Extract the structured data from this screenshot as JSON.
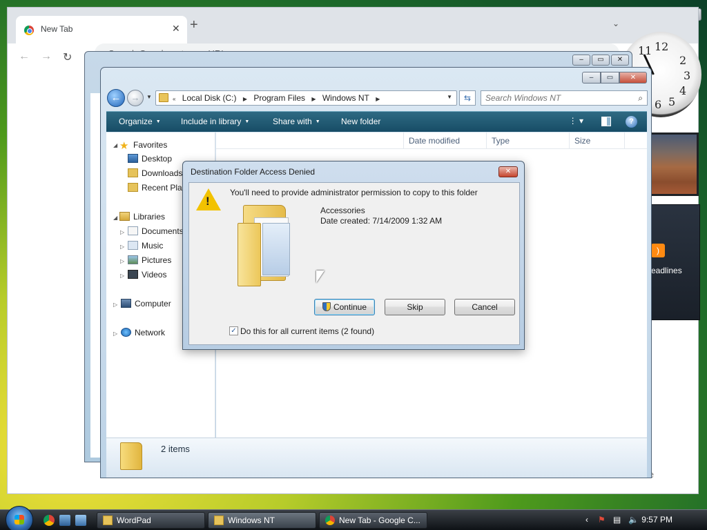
{
  "chrome": {
    "tab_title": "New Tab",
    "omnibox_placeholder": "Search Google or type a URL",
    "shortcut_text": "hrome"
  },
  "gadgets": {
    "feed_label": "eadlines"
  },
  "explorer": {
    "breadcrumbs": [
      "Local Disk (C:)",
      "Program Files",
      "Windows NT"
    ],
    "search_placeholder": "Search Windows NT",
    "toolbar": {
      "organize": "Organize",
      "include": "Include in library",
      "share": "Share with",
      "new_folder": "New folder"
    },
    "nav": {
      "favorites": "Favorites",
      "desktop": "Desktop",
      "downloads": "Downloads",
      "recent": "Recent Plac",
      "libraries": "Libraries",
      "documents": "Documents",
      "music": "Music",
      "pictures": "Pictures",
      "videos": "Videos",
      "computer": "Computer",
      "network": "Network"
    },
    "columns": {
      "name": "",
      "date": "Date modified",
      "type": "Type",
      "size": "Size"
    },
    "status_count": "2 items"
  },
  "dialog": {
    "title": "Destination Folder Access Denied",
    "message": "You'll need to provide administrator permission to copy to this folder",
    "item_name": "Accessories",
    "item_date": "Date created: 7/14/2009 1:32 AM",
    "continue_label": "Continue",
    "skip_label": "Skip",
    "cancel_label": "Cancel",
    "checkbox_label": "Do this for all current items (2 found)",
    "checkbox_checked": true
  },
  "taskbar": {
    "tasks": [
      "WordPad",
      "Windows NT",
      "New Tab - Google C..."
    ],
    "clock": "9:57 PM"
  },
  "colors": {
    "accent": "#174c66",
    "dialog_frame": "#b7cde3",
    "warning": "#f2c200"
  }
}
